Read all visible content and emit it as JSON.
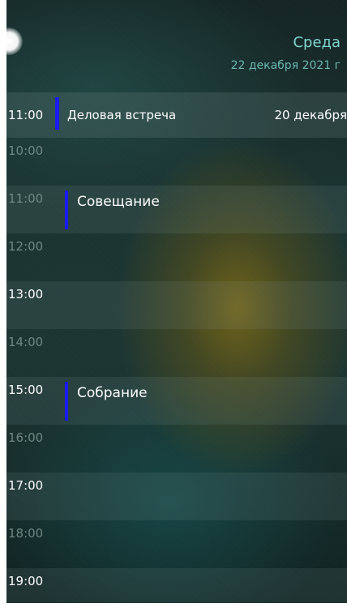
{
  "header": {
    "day_name": "Среда",
    "date": "22 декабря 2021 г"
  },
  "upcoming_event": {
    "time": "11:00",
    "title": "Деловая встреча",
    "date": "20 декабря"
  },
  "timeline": [
    {
      "time": "10:00",
      "title": ""
    },
    {
      "time": "11:00",
      "title": "Совещание"
    },
    {
      "time": "12:00",
      "title": ""
    },
    {
      "time": "13:00",
      "title": ""
    },
    {
      "time": "14:00",
      "title": ""
    },
    {
      "time": "15:00",
      "title": "Собрание"
    },
    {
      "time": "16:00",
      "title": ""
    },
    {
      "time": "17:00",
      "title": ""
    },
    {
      "time": "18:00",
      "title": ""
    },
    {
      "time": "19:00",
      "title": ""
    }
  ],
  "colors": {
    "accent": "#7fd6ce",
    "event_marker": "#1b1bf0"
  }
}
